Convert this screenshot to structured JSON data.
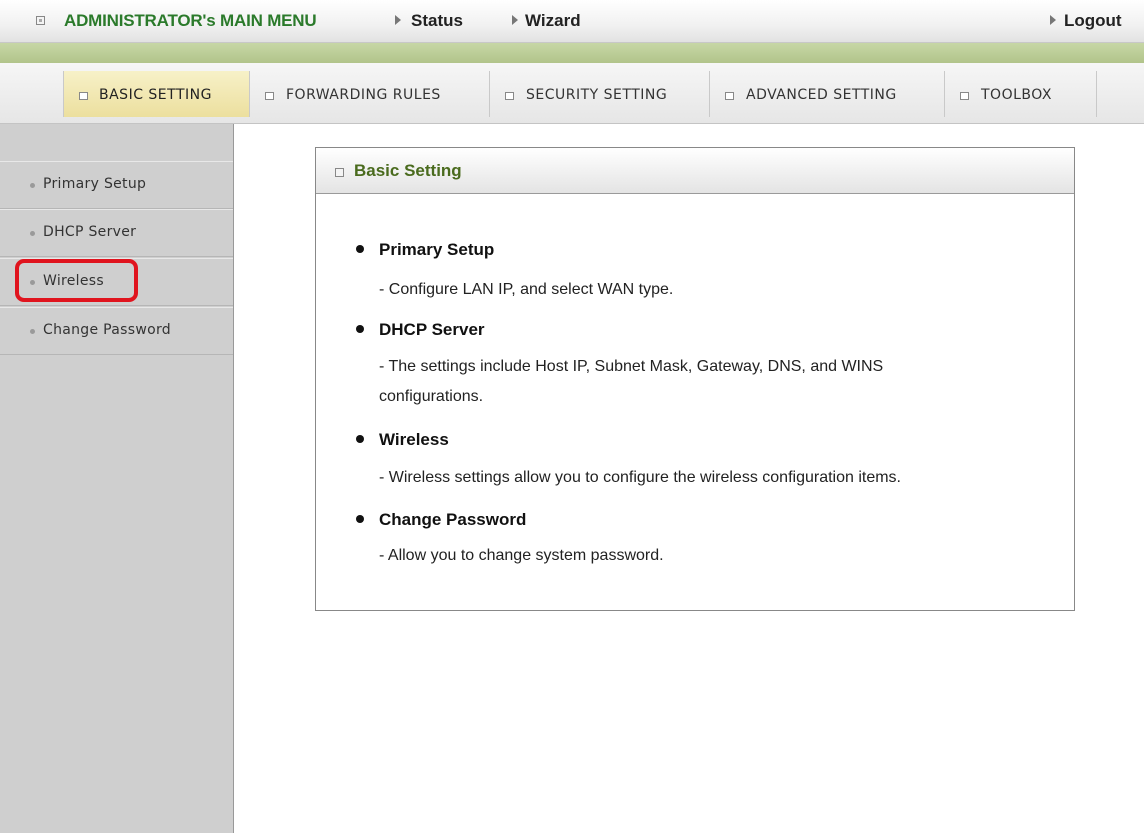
{
  "topbar": {
    "menu_title": "ADMINISTRATOR's MAIN MENU",
    "status": "Status",
    "wizard": "Wizard",
    "logout": "Logout"
  },
  "tabs": [
    {
      "label": "BASIC SETTING",
      "active": true
    },
    {
      "label": "FORWARDING RULES",
      "active": false
    },
    {
      "label": "SECURITY SETTING",
      "active": false
    },
    {
      "label": "ADVANCED SETTING",
      "active": false
    },
    {
      "label": "TOOLBOX",
      "active": false
    }
  ],
  "sidebar": {
    "items": [
      {
        "label": "Primary Setup"
      },
      {
        "label": "DHCP Server"
      },
      {
        "label": "Wireless"
      },
      {
        "label": "Change Password"
      }
    ],
    "highlight_color": "#e0141e"
  },
  "panel": {
    "title": "Basic Setting",
    "entries": [
      {
        "title": "Primary Setup",
        "desc": "- Configure LAN IP, and select WAN type."
      },
      {
        "title": "DHCP Server",
        "desc": "- The settings include Host IP, Subnet Mask, Gateway, DNS, and WINS configurations."
      },
      {
        "title": "Wireless",
        "desc": "- Wireless settings allow you to configure the wireless configuration items."
      },
      {
        "title": "Change Password",
        "desc": "- Allow you to change system password."
      }
    ]
  },
  "colors": {
    "brand_green": "#2b7a2b",
    "band_green": "#b1c48a",
    "active_tab": "#ecdf9e"
  }
}
